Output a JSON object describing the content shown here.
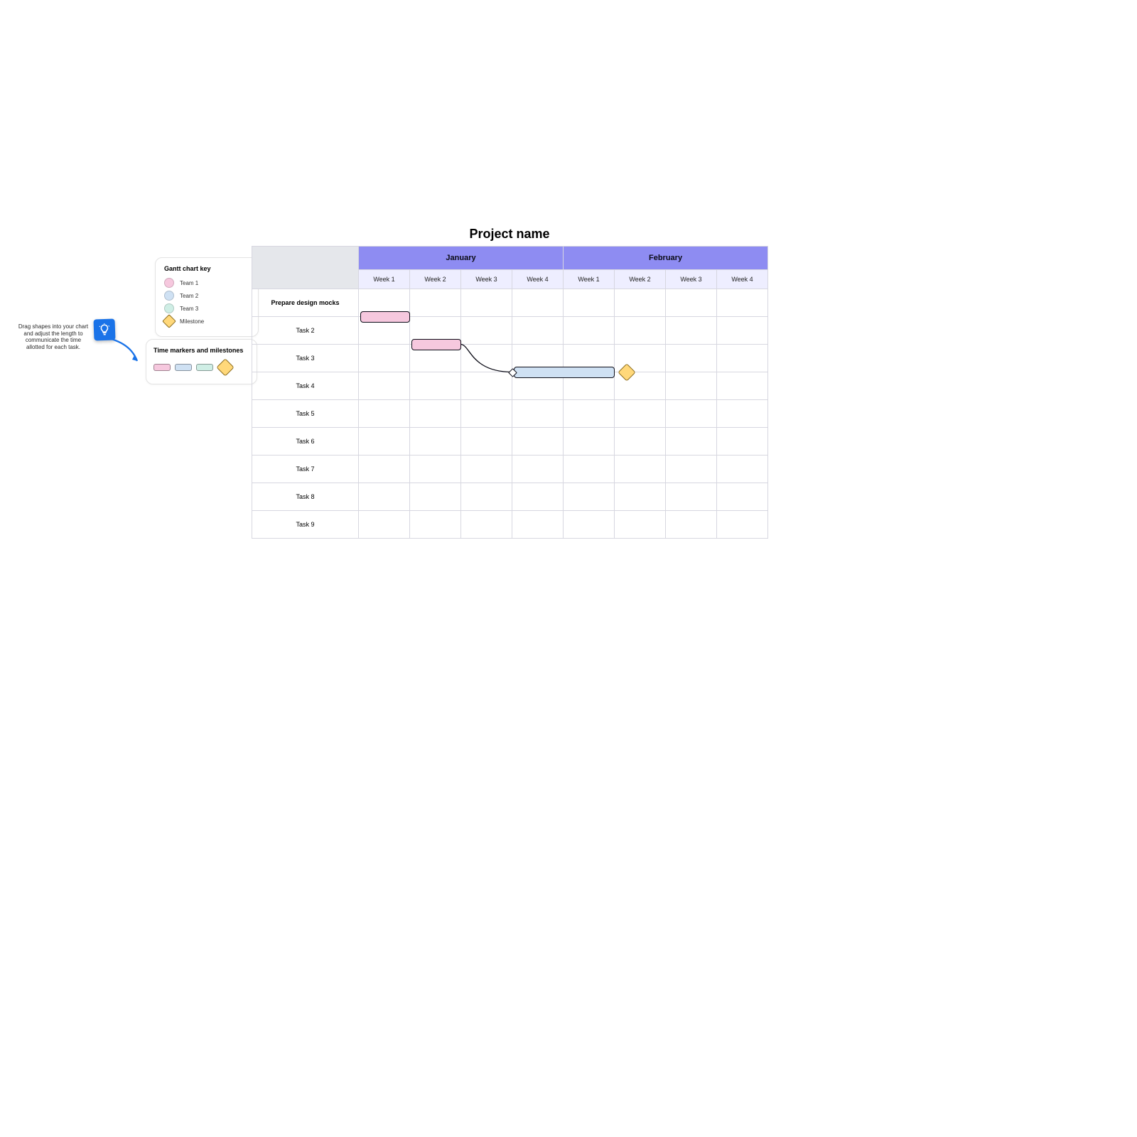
{
  "hint": {
    "text": "Drag shapes into your chart and adjust the length to communicate the time allotted for each task."
  },
  "legend": {
    "title": "Gantt chart key",
    "items": [
      {
        "label": "Team 1",
        "color": "#f6c8de"
      },
      {
        "label": "Team 2",
        "color": "#cfe1f3"
      },
      {
        "label": "Team 3",
        "color": "#cfeee5"
      }
    ],
    "milestone_label": "Milestone"
  },
  "palette": {
    "title": "Time markers and milestones",
    "markers": [
      {
        "name": "team1-marker",
        "color": "#f6c8de"
      },
      {
        "name": "team2-marker",
        "color": "#cfe1f3"
      },
      {
        "name": "team3-marker",
        "color": "#cfeee5"
      }
    ]
  },
  "project": {
    "title": "Project name"
  },
  "months": [
    "January",
    "February"
  ],
  "weeks": [
    "Week 1",
    "Week 2",
    "Week 3",
    "Week 4",
    "Week 1",
    "Week 2",
    "Week 3",
    "Week 4"
  ],
  "tasks": [
    {
      "label": "Prepare design mocks",
      "bold": true
    },
    {
      "label": "Task 2",
      "bold": false
    },
    {
      "label": "Task 3",
      "bold": false
    },
    {
      "label": "Task 4",
      "bold": false
    },
    {
      "label": "Task 5",
      "bold": false
    },
    {
      "label": "Task 6",
      "bold": false
    },
    {
      "label": "Task 7",
      "bold": false
    },
    {
      "label": "Task 8",
      "bold": false
    },
    {
      "label": "Task 9",
      "bold": false
    }
  ],
  "chart_data": {
    "type": "bar",
    "title": "Project name",
    "x_unit": "week",
    "months": [
      "January",
      "February"
    ],
    "weeks_per_month": 4,
    "categories": [
      "Prepare design mocks",
      "Task 2",
      "Task 3",
      "Task 4",
      "Task 5",
      "Task 6",
      "Task 7",
      "Task 8",
      "Task 9"
    ],
    "series": [
      {
        "name": "Team 1",
        "color": "#f6c8de"
      },
      {
        "name": "Team 2",
        "color": "#cfe1f3"
      },
      {
        "name": "Team 3",
        "color": "#cfeee5"
      }
    ],
    "bars": [
      {
        "task_index": 0,
        "team": "Team 1",
        "start_week": 1,
        "duration_weeks": 1.0
      },
      {
        "task_index": 1,
        "team": "Team 1",
        "start_week": 2,
        "duration_weeks": 1.0
      },
      {
        "task_index": 2,
        "team": "Team 2",
        "start_week": 4,
        "duration_weeks": 2.0
      }
    ],
    "milestones": [
      {
        "task_index": 2,
        "week": 6.0
      }
    ],
    "dependencies": [
      {
        "from_task": 1,
        "to_task": 2
      }
    ]
  },
  "colors": {
    "team1": "#f6c8de",
    "team2": "#cfe1f3",
    "team3": "#cfeee5",
    "milestone_fill": "#ffd87a",
    "milestone_border": "#8c6d1f",
    "month_header": "#8e8cf2",
    "week_header": "#eeeeff"
  }
}
